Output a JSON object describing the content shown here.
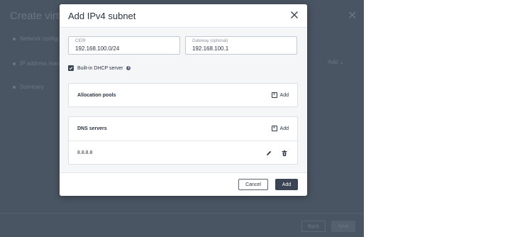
{
  "background": {
    "title": "Create virtual",
    "steps": [
      {
        "label": "Network configuration"
      },
      {
        "label": "IP address management"
      },
      {
        "label": "Summary"
      }
    ],
    "add_label": "Add",
    "back_label": "Back",
    "next_label": "Next"
  },
  "modal": {
    "title": "Add IPv4 subnet",
    "cidr": {
      "label": "CIDR",
      "value": "192.168.100.0/24"
    },
    "gateway": {
      "label": "Gateway (optional)",
      "value": "192.168.100.1"
    },
    "dhcp": {
      "label": "Built-in DHCP server",
      "checked": true
    },
    "allocation_pools": {
      "title": "Allocation pools",
      "add_label": "Add"
    },
    "dns_servers": {
      "title": "DNS servers",
      "add_label": "Add",
      "entries": [
        "8.8.8.8"
      ]
    },
    "cancel_label": "Cancel",
    "add_label": "Add"
  },
  "colors": {
    "overlay": "#4a5563",
    "primary_button": "#3a4453",
    "text": "#2b3442"
  },
  "icons": [
    "close-icon",
    "checkbox-checked-icon",
    "info-icon",
    "plus-box-icon",
    "pencil-icon",
    "trash-icon"
  ]
}
